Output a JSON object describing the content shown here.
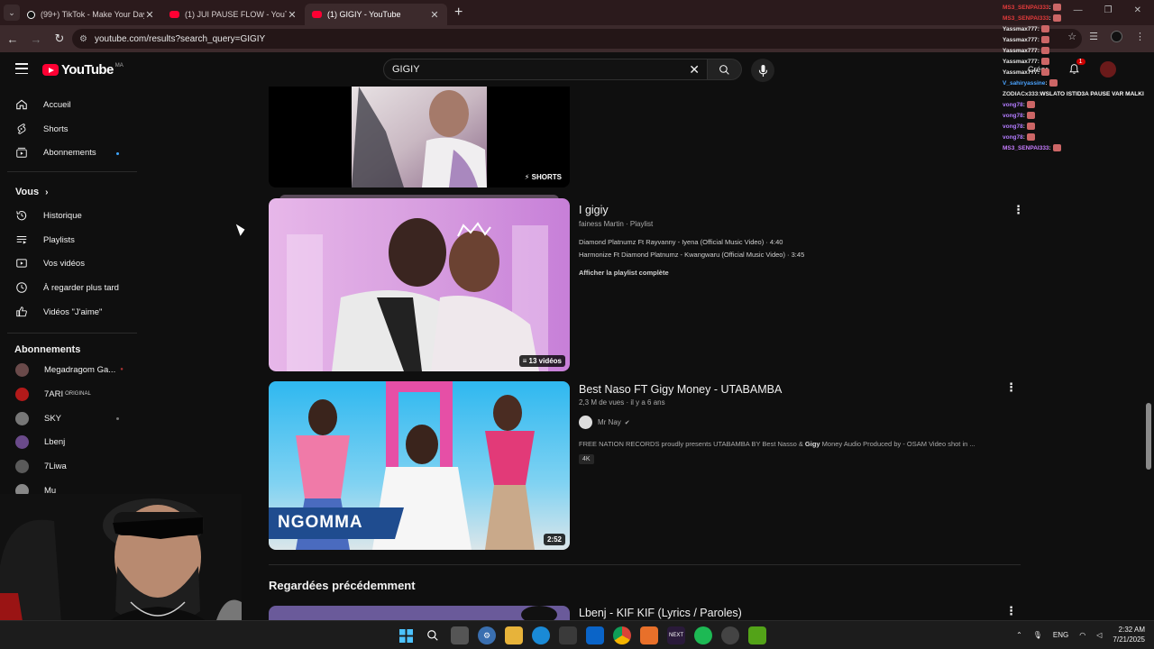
{
  "browser": {
    "tabs": [
      {
        "label": "(99+) TikTok - Make Your Day",
        "favicon": "tiktok-icon",
        "active": false
      },
      {
        "label": "(1) JUI PAUSE FLOW - YouTube",
        "favicon": "youtube-icon",
        "active": false
      },
      {
        "label": "(1) GIGIY - YouTube",
        "favicon": "youtube-icon",
        "active": true
      }
    ],
    "new_tab": "+",
    "url": "youtube.com/results?search_query=GIGIY"
  },
  "header": {
    "logo_text": "YouTube",
    "country_code": "MA",
    "search_value": "GIGIY",
    "create_label": "Créer",
    "notification_count": "1"
  },
  "sidebar": {
    "main": [
      {
        "label": "Accueil",
        "icon": "home-icon"
      },
      {
        "label": "Shorts",
        "icon": "shorts-icon"
      },
      {
        "label": "Abonnements",
        "icon": "subscriptions-icon"
      }
    ],
    "you_heading": "Vous",
    "you_items": [
      {
        "label": "Historique",
        "icon": "history-icon"
      },
      {
        "label": "Playlists",
        "icon": "playlists-icon"
      },
      {
        "label": "Vos vidéos",
        "icon": "your-videos-icon"
      },
      {
        "label": "À regarder plus tard",
        "icon": "watch-later-icon"
      },
      {
        "label": "Vidéos \"J'aime\"",
        "icon": "liked-videos-icon"
      }
    ],
    "subs_heading": "Abonnements",
    "subscriptions": [
      {
        "label": "Megadragom Ga...",
        "color": "#6a4a4a"
      },
      {
        "label": "7ARI",
        "suffix": "ORIGINAL",
        "color": "#b21a1a"
      },
      {
        "label": "SKY",
        "color": "#777777"
      },
      {
        "label": "Lbenj",
        "color": "#6a4a8a"
      },
      {
        "label": "7Liwa",
        "color": "#5a5a5a"
      },
      {
        "label": "Mu",
        "color": "#888888"
      }
    ]
  },
  "results": {
    "shorts_badge": "SHORTS",
    "playlist": {
      "title": "I gigiy",
      "meta": "fainess Martin · Playlist",
      "items": [
        "Diamond Platnumz Ft Rayvanny - Iyena (Official Music Video) · 4:40",
        "Harmonize Ft Diamond Platnumz - Kwangwaru (Official Music Video) · 3:45"
      ],
      "view_all": "Afficher la playlist complète",
      "video_count": "13 vidéos"
    },
    "video": {
      "title": "Best Naso FT Gigy Money - UTABAMBA",
      "meta": "2,3 M de vues · il y a 6 ans",
      "channel": "Mr Nay",
      "description_before": "FREE NATION RECORDS proudly presents UTABAMBA BY Best Nasso & ",
      "description_bold": "Gigy",
      "description_after": " Money Audio Produced by - OSAM Video shot in ...",
      "badge": "4K",
      "duration": "2:52",
      "thumb_text": "NGOMMA"
    },
    "previously_watched_heading": "Regardées précédemment",
    "next_video_title": "Lbenj - KIF KIF (Lyrics / Paroles)"
  },
  "chat": [
    {
      "user": "MS3_SENPAI333",
      "msg": "",
      "color": "#e23b3b"
    },
    {
      "user": "MS3_SENPAI333",
      "msg": "",
      "color": "#e23b3b"
    },
    {
      "user": "Yassmax777",
      "msg": "",
      "color": "#e6e6e6"
    },
    {
      "user": "Yassmax777",
      "msg": "",
      "color": "#e6e6e6"
    },
    {
      "user": "Yassmax777",
      "msg": "",
      "color": "#e6e6e6"
    },
    {
      "user": "Yassmax777",
      "msg": "",
      "color": "#e6e6e6"
    },
    {
      "user": "Yassmax777",
      "msg": "",
      "color": "#e6e6e6"
    },
    {
      "user": "V_sahiryassine",
      "msg": "",
      "color": "#4aa3ff"
    },
    {
      "user": "ZODIACx333",
      "msg": "WSLATO ISTID3A PAUSE VAR MALKI",
      "color": "#e6e6e6"
    },
    {
      "user": "vong78",
      "msg": "",
      "color": "#b37cff"
    },
    {
      "user": "vong78",
      "msg": "",
      "color": "#b37cff"
    },
    {
      "user": "vong78",
      "msg": "",
      "color": "#b37cff"
    },
    {
      "user": "vong78",
      "msg": "",
      "color": "#b37cff"
    },
    {
      "user": "MS3_SENPAI333",
      "msg": "",
      "color": "#c77dff"
    }
  ],
  "taskbar": {
    "language": "ENG",
    "time": "2:32 AM",
    "date": "7/21/2025"
  }
}
